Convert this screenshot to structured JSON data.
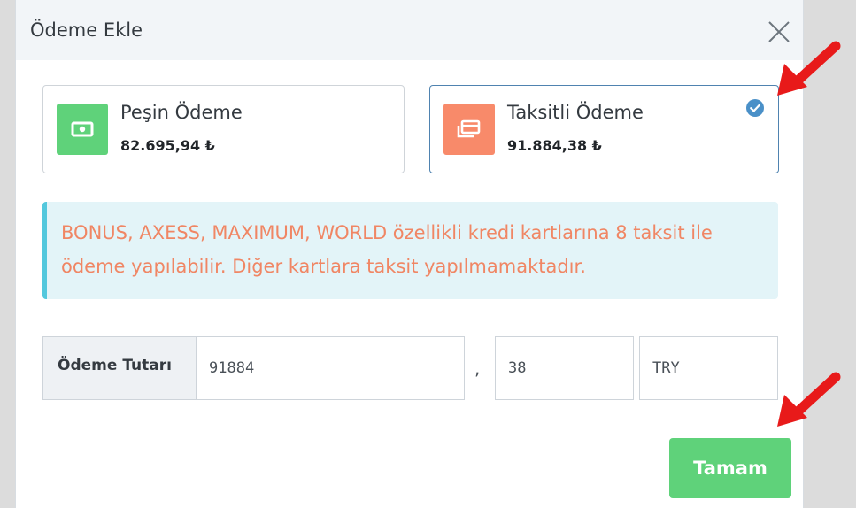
{
  "modal": {
    "title": "Ödeme Ekle"
  },
  "options": [
    {
      "title": "Peşin Ödeme",
      "amount": "82.695,94 ₺",
      "icon": "cash-icon",
      "color": "#5fd27a",
      "selected": false
    },
    {
      "title": "Taksitli Ödeme",
      "amount": "91.884,38 ₺",
      "icon": "credit-card-icon",
      "color": "#f88a6a",
      "selected": true
    }
  ],
  "alert": {
    "text": "BONUS, AXESS, MAXIMUM, WORLD özellikli kredi kartlarına 8 taksit ile ödeme yapılabilir. Diğer kartlara taksit yapılmamaktadır."
  },
  "payment_form": {
    "label": "Ödeme Tutarı",
    "amount_integer": "91884",
    "separator": ",",
    "amount_decimal": "38",
    "currency": "TRY"
  },
  "actions": {
    "ok_label": "Tamam"
  },
  "colors": {
    "accent_green": "#5fd27a",
    "accent_orange": "#f88a6a",
    "check_blue": "#4a90c8",
    "annotation_red": "#e81a1a"
  }
}
